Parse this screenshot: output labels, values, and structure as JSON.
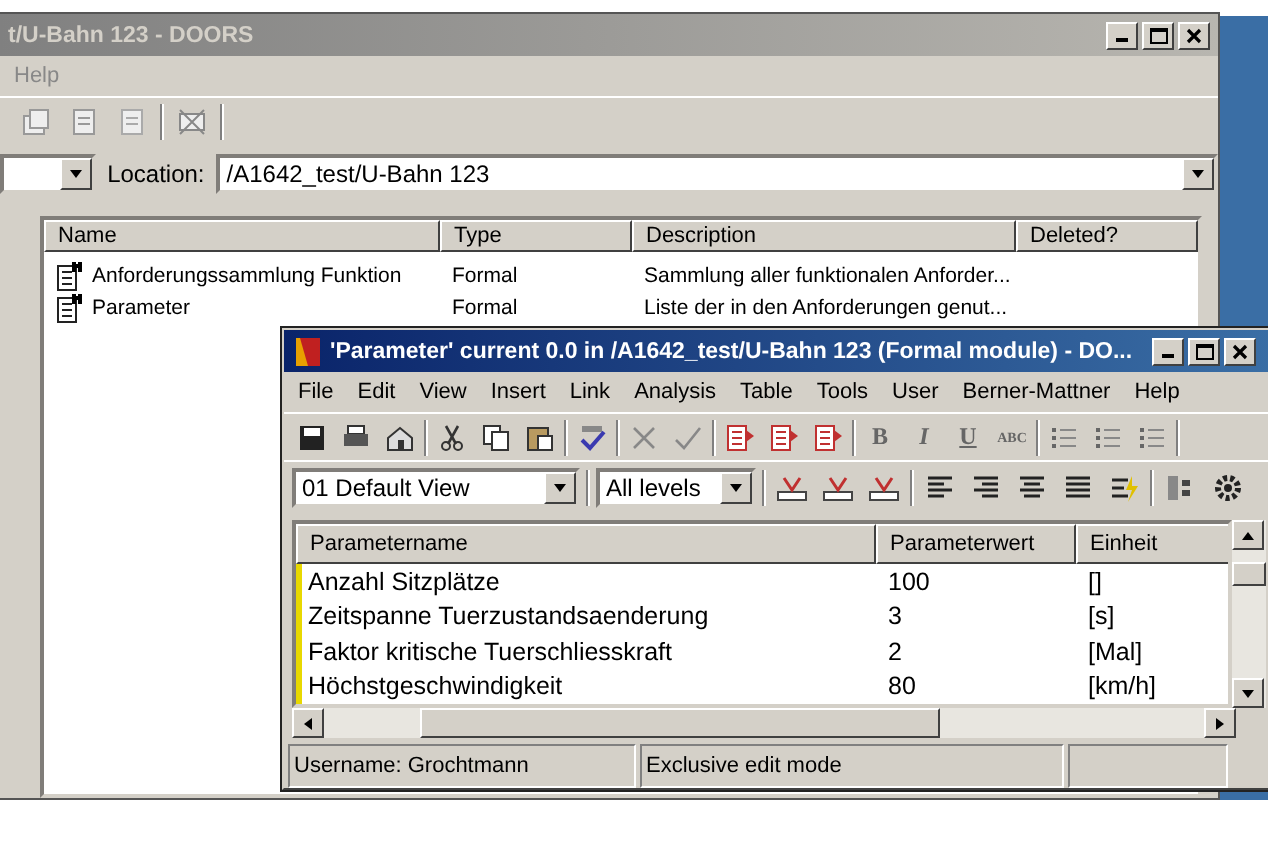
{
  "back_window": {
    "title": "t/U-Bahn 123 - DOORS",
    "menu": [
      "Help"
    ],
    "location_label": "Location:",
    "location": "/A1642_test/U-Bahn 123",
    "columns": [
      "Name",
      "Type",
      "Description",
      "Deleted?"
    ],
    "rows": [
      {
        "name": "Anforderungssammlung Funktion",
        "type": "Formal",
        "description": "Sammlung aller funktionalen Anforder..."
      },
      {
        "name": "Parameter",
        "type": "Formal",
        "description": "Liste der in den Anforderungen genut..."
      }
    ]
  },
  "module_window": {
    "title": "'Parameter' current 0.0 in /A1642_test/U-Bahn 123 (Formal module) - DO...",
    "menu": [
      "File",
      "Edit",
      "View",
      "Insert",
      "Link",
      "Analysis",
      "Table",
      "Tools",
      "User",
      "Berner-Mattner",
      "Help"
    ],
    "format_buttons": [
      "B",
      "I",
      "U",
      "ABC"
    ],
    "view": "01 Default View",
    "levels": "All levels",
    "columns": [
      "Parametername",
      "Parameterwert",
      "Einheit"
    ],
    "rows": [
      {
        "name": "Anzahl Sitzplätze",
        "value": "100",
        "unit": "[]"
      },
      {
        "name": "Zeitspanne Tuerzustandsaenderung",
        "value": "3",
        "unit": "[s]"
      },
      {
        "name": "Faktor kritische Tuerschliesskraft",
        "value": "2",
        "unit": "[Mal]"
      },
      {
        "name": "Höchstgeschwindigkeit",
        "value": "80",
        "unit": "[km/h]"
      }
    ],
    "status": [
      "Username: Grochtmann",
      "Exclusive edit mode"
    ]
  }
}
